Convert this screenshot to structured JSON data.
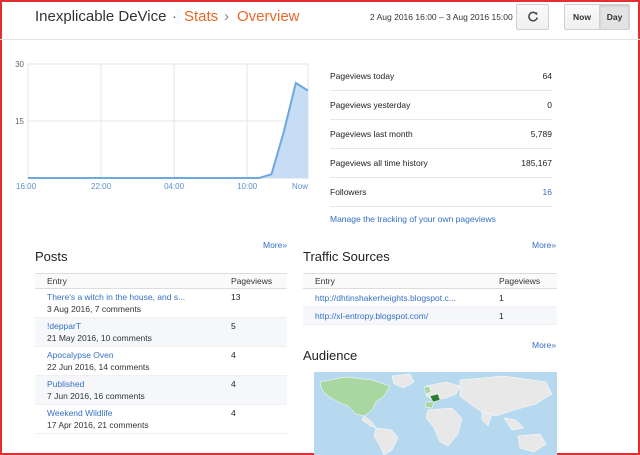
{
  "header": {
    "blog_name": "Inexplicable DeVice",
    "separator": "·",
    "crumb_stats": "Stats",
    "crumb_arrow": "›",
    "crumb_overview": "Overview",
    "date_range": "2 Aug 2016 16:00 – 3 Aug 2016 15:00",
    "refresh_icon": "refresh-icon",
    "now_label": "Now",
    "day_label": "Day"
  },
  "chart_data": {
    "type": "area",
    "x": [
      "16:00",
      "17:00",
      "18:00",
      "19:00",
      "20:00",
      "21:00",
      "22:00",
      "23:00",
      "00:00",
      "01:00",
      "02:00",
      "03:00",
      "04:00",
      "05:00",
      "06:00",
      "07:00",
      "08:00",
      "09:00",
      "10:00",
      "11:00",
      "12:00",
      "13:00",
      "14:00",
      "Now"
    ],
    "x_tick_labels": [
      "16:00",
      "22:00",
      "04:00",
      "10:00",
      "Now"
    ],
    "y_tick_labels": [
      "30",
      "15"
    ],
    "values": [
      0,
      0,
      0,
      0,
      0,
      0,
      0,
      0,
      0,
      0,
      0,
      0,
      0,
      0,
      0,
      0,
      0,
      0,
      0,
      0,
      1,
      12,
      25,
      23
    ],
    "ylim": [
      0,
      30
    ],
    "grid": true,
    "colors": {
      "line": "#6fa8dc",
      "fill": "#c7dcf5",
      "grid": "#e6e6e6",
      "axis_label": "#5a8ed0"
    }
  },
  "stats": [
    {
      "label": "Pageviews today",
      "value": "64",
      "is_link": false
    },
    {
      "label": "Pageviews yesterday",
      "value": "0",
      "is_link": false
    },
    {
      "label": "Pageviews last month",
      "value": "5,789",
      "is_link": false
    },
    {
      "label": "Pageviews all time history",
      "value": "185,167",
      "is_link": false
    },
    {
      "label": "Followers",
      "value": "16",
      "is_link": true
    }
  ],
  "manage_link": "Manage the tracking of your own pageviews",
  "posts": {
    "title": "Posts",
    "more": "More»",
    "col_entry": "Entry",
    "col_pageviews": "Pageviews",
    "rows": [
      {
        "title": "There's a witch in the house, and s...",
        "meta": "3 Aug 2016, 7 comments",
        "views": "13"
      },
      {
        "title": "!depparT",
        "meta": "21 May 2016, 10 comments",
        "views": "5"
      },
      {
        "title": "Apocalypse Oven",
        "meta": "22 Jun 2016, 14 comments",
        "views": "4"
      },
      {
        "title": "Published",
        "meta": "7 Jun 2016, 16 comments",
        "views": "4"
      },
      {
        "title": "Weekend Wildlife",
        "meta": "17 Apr 2016, 21 comments",
        "views": "4"
      }
    ]
  },
  "traffic": {
    "title": "Traffic Sources",
    "more": "More»",
    "col_entry": "Entry",
    "col_pageviews": "Pageviews",
    "rows": [
      {
        "url": "http://dhtinshakerheights.blogspot.c...",
        "views": "1"
      },
      {
        "url": "http://xl-entropy.blogspot.com/",
        "views": "1"
      }
    ]
  },
  "audience": {
    "title": "Audience",
    "more": "More»",
    "colors": {
      "ocean": "#b7d9f0",
      "land": "#e8e8e8",
      "low": "#a8d8a0",
      "high": "#2e7d32"
    }
  }
}
